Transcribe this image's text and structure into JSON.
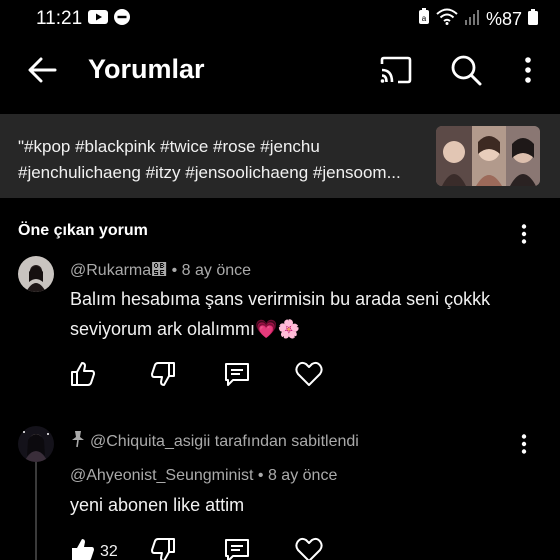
{
  "status_bar": {
    "time": "11:21",
    "battery_text": "%87"
  },
  "app_bar": {
    "title": "Yorumlar",
    "icons": [
      "arrow-left-icon",
      "cast-icon",
      "search-icon",
      "more-vertical-icon"
    ]
  },
  "video": {
    "description": "\"#kpop #blackpink #twice #rose #jenchu #jenchulichaeng #itzy #jensoolichaeng #jensoom..."
  },
  "section": {
    "header": "Öne çıkan yorum"
  },
  "comments": [
    {
      "author": "@Rukarma",
      "author_suffix": "୞",
      "age": "8 ay önce",
      "text": "Balım hesabıma şans verirmisin bu arada seni çokkk seviyorum ark olalımmı",
      "emojis": "💗🌸",
      "likes": ""
    },
    {
      "pinned_by": "@Chiquita_asigii tarafından sabitlendi",
      "author": "@Ahyeonist_Seungminist",
      "age": "8 ay önce",
      "text": "yeni abonen like attim",
      "likes": "32"
    }
  ],
  "colors": {
    "background": "#000000",
    "context_background": "#272727",
    "secondary_text": "#aaaaaa"
  }
}
